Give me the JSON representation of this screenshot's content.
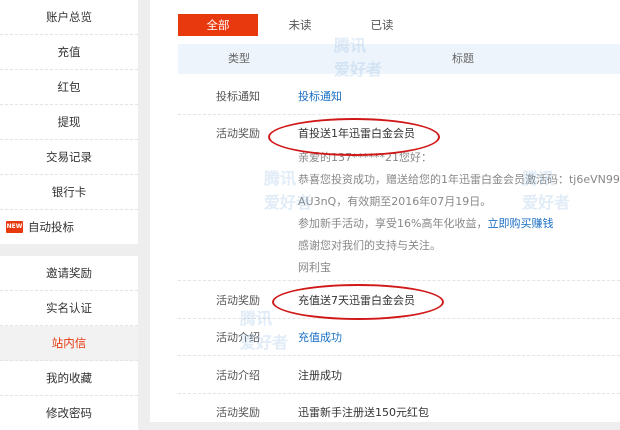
{
  "sidebar": {
    "group1": [
      {
        "label": "账户总览",
        "name": "sidebar-item-account-overview"
      },
      {
        "label": "充值",
        "name": "sidebar-item-recharge"
      },
      {
        "label": "红包",
        "name": "sidebar-item-red-packet"
      },
      {
        "label": "提现",
        "name": "sidebar-item-withdraw"
      },
      {
        "label": "交易记录",
        "name": "sidebar-item-transactions"
      },
      {
        "label": "银行卡",
        "name": "sidebar-item-bank-card"
      },
      {
        "label": "自动投标",
        "name": "sidebar-item-auto-bid",
        "badge": "NEW"
      }
    ],
    "group2": [
      {
        "label": "邀请奖励",
        "name": "sidebar-item-invite-reward"
      },
      {
        "label": "实名认证",
        "name": "sidebar-item-real-name"
      },
      {
        "label": "站内信",
        "name": "sidebar-item-messages",
        "active": true
      },
      {
        "label": "我的收藏",
        "name": "sidebar-item-favorites"
      },
      {
        "label": "修改密码",
        "name": "sidebar-item-change-password"
      }
    ]
  },
  "tabs": [
    "全部",
    "未读",
    "已读"
  ],
  "table": {
    "headers": {
      "type": "类型",
      "title": "标题"
    },
    "rows": [
      {
        "type": "投标通知",
        "title": "投标通知",
        "title_link": true
      },
      {
        "type": "活动奖励",
        "title": "首投送1年迅雷白金会员",
        "details": {
          "greeting": "亲爱的137******21您好：",
          "line1": "恭喜您投资成功，赠送给您的1年迅雷白金会员激活码：tj6eVN99vG",
          "line2": "AU3nQ，有效期至2016年07月19日。",
          "line3_prefix": "参加新手活动，享受16%高年化收益，",
          "line3_link": "立即购买赚钱",
          "line4": "感谢您对我们的支持与关注。",
          "signature": "网利宝"
        }
      },
      {
        "type": "活动奖励",
        "title": "充值送7天迅雷白金会员"
      },
      {
        "type": "活动介绍",
        "title": "充值成功",
        "title_link": true
      },
      {
        "type": "活动介绍",
        "title": "注册成功"
      },
      {
        "type": "活动奖励",
        "title": "迅雷新手注册送150元红包"
      }
    ]
  },
  "watermark": {
    "text": "腾讯\n爱好者",
    "url": "www.txshz.com"
  },
  "colors": {
    "accent": "#e8380d",
    "link": "#1a6fc4",
    "annotation": "#d01818",
    "header_bg": "#edf4fb"
  }
}
